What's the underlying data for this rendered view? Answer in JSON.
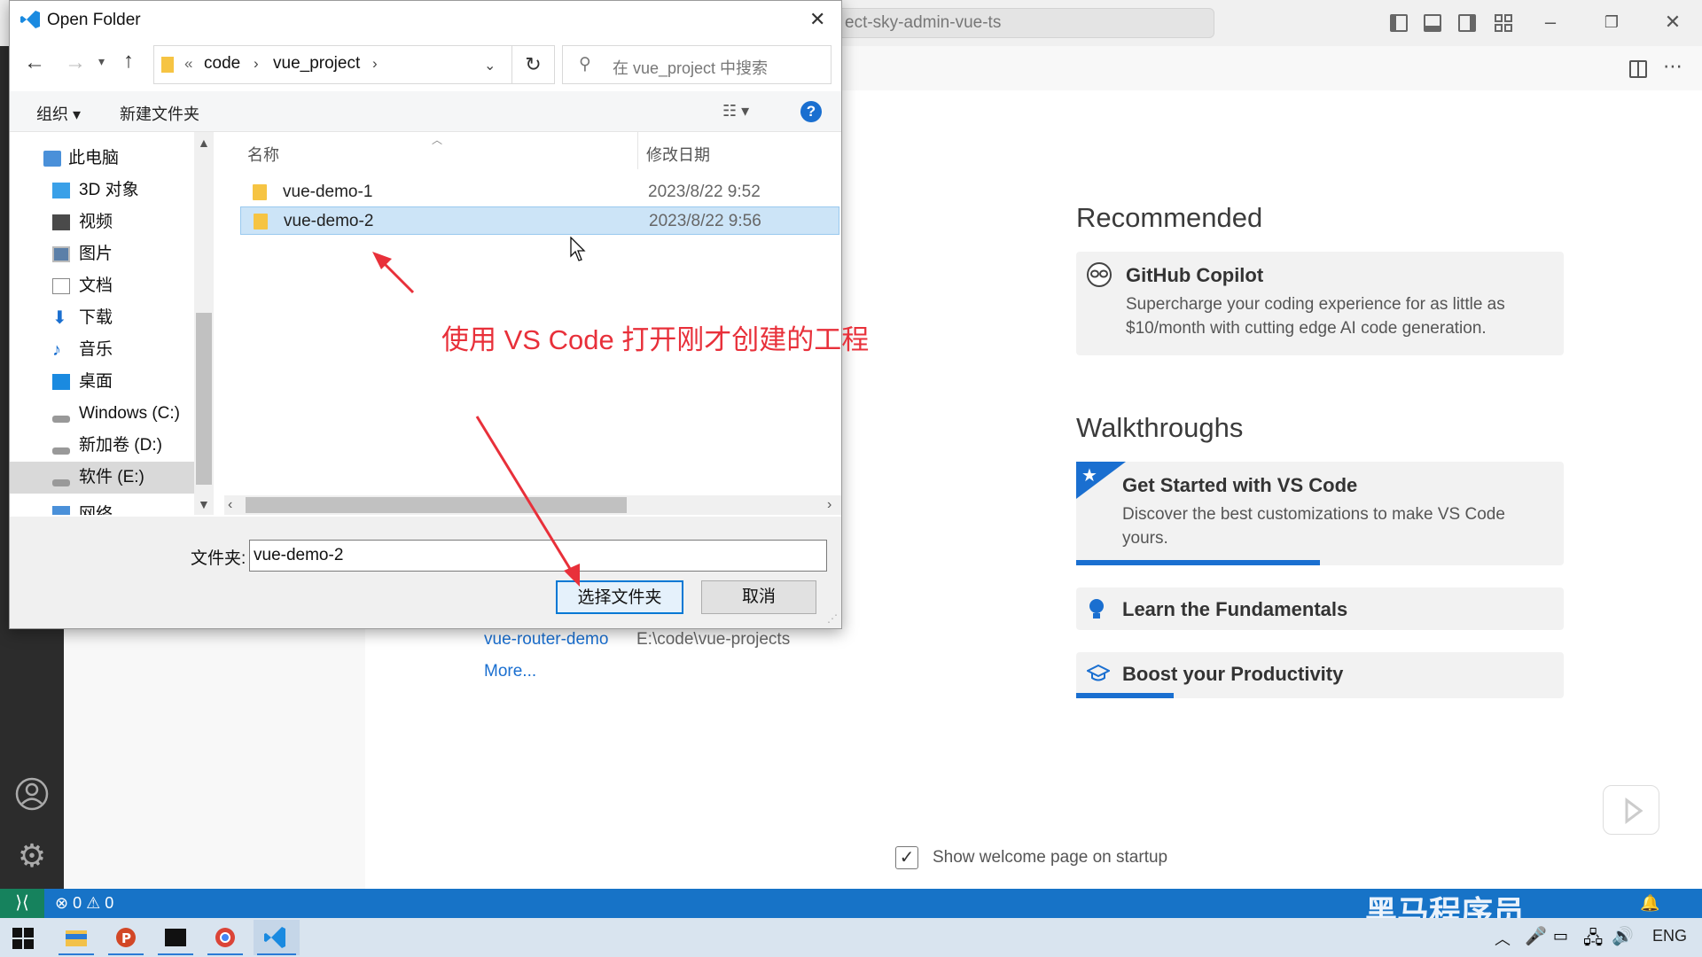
{
  "vscode": {
    "command_center": "ect-sky-admin-vue-ts",
    "recommended": {
      "title": "Recommended",
      "copilot_title": "GitHub Copilot",
      "copilot_desc": "Supercharge your coding experience for as little as $10/month with cutting edge AI code generation."
    },
    "walkthroughs": {
      "title": "Walkthroughs",
      "items": [
        {
          "title": "Get Started with VS Code",
          "desc": "Discover the best customizations to make VS Code yours.",
          "progress": 0.5
        },
        {
          "title": "Learn the Fundamentals"
        },
        {
          "title": "Boost your Productivity",
          "progress": 0.2
        }
      ]
    },
    "recent": [
      {
        "name": "vue-router-demo",
        "path": "E:\\code\\vue-projects"
      }
    ],
    "more_label": "More...",
    "startup_checkbox_label": "Show welcome page on startup",
    "startup_checked": true,
    "status": {
      "errors": "0",
      "warnings": "0"
    }
  },
  "watermark": "黑马程序员",
  "dialog": {
    "title": "Open Folder",
    "breadcrumb": [
      "«",
      "code",
      "vue_project"
    ],
    "search_placeholder": "在 vue_project 中搜索",
    "organize_label": "组织 ▾",
    "new_folder_label": "新建文件夹",
    "tree": [
      {
        "label": "此电脑",
        "icon": "pc-icon"
      },
      {
        "label": "3D 对象",
        "icon": "cube-icon"
      },
      {
        "label": "视频",
        "icon": "video-icon"
      },
      {
        "label": "图片",
        "icon": "pictures-icon"
      },
      {
        "label": "文档",
        "icon": "documents-icon"
      },
      {
        "label": "下载",
        "icon": "download-icon"
      },
      {
        "label": "音乐",
        "icon": "music-icon"
      },
      {
        "label": "桌面",
        "icon": "desktop-icon"
      },
      {
        "label": "Windows (C:)",
        "icon": "drive-icon"
      },
      {
        "label": "新加卷 (D:)",
        "icon": "drive-icon"
      },
      {
        "label": "软件 (E:)",
        "icon": "drive-icon",
        "selected": true
      },
      {
        "label": "网络",
        "icon": "network-icon"
      }
    ],
    "columns": {
      "name": "名称",
      "date": "修改日期"
    },
    "rows": [
      {
        "name": "vue-demo-1",
        "date": "2023/8/22 9:52"
      },
      {
        "name": "vue-demo-2",
        "date": "2023/8/22 9:56",
        "selected": true
      }
    ],
    "folder_label": "文件夹:",
    "folder_value": "vue-demo-2",
    "select_button": "选择文件夹",
    "cancel_button": "取消"
  },
  "annotation": "使用 VS Code 打开刚才创建的工程",
  "taskbar": {
    "lang": "ENG"
  },
  "colors": {
    "accent": "#0078d4",
    "annotation": "#e8303a",
    "status_bar": "#1773c7"
  }
}
